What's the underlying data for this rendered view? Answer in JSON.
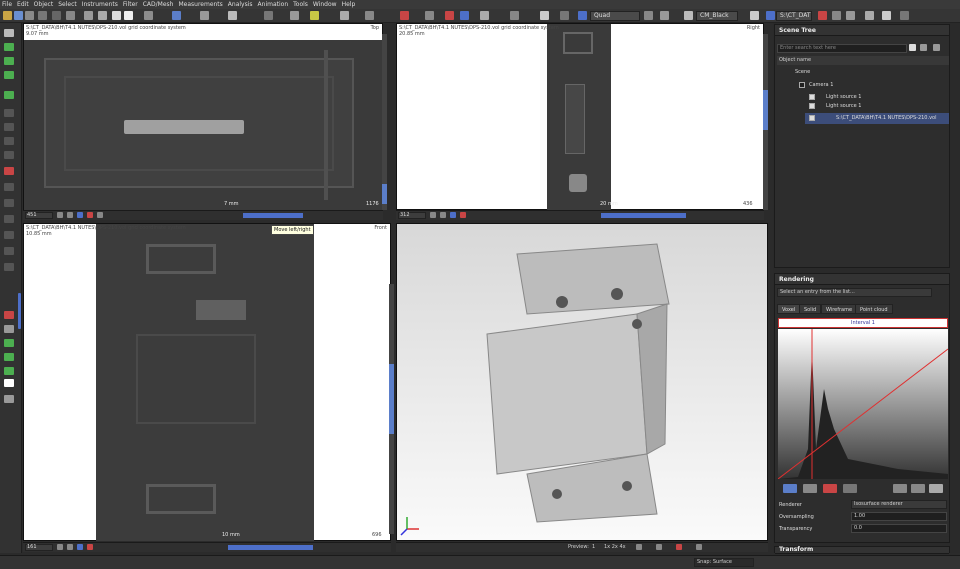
{
  "menu": [
    "File",
    "Edit",
    "Object",
    "Select",
    "Instruments",
    "Filter",
    "CAD/Mesh",
    "Measurements",
    "Analysis",
    "Animation",
    "Tools",
    "Window",
    "Help"
  ],
  "toolbar": {
    "quad_label": "Quad",
    "colormap_label": "CM_Black",
    "path_label": "S:\\CT_DAT"
  },
  "viewports": {
    "top": {
      "path": "S:\\CT_DATA\\BH\\T4.1 NUTES\\DPS-210.vol grid coordinate system",
      "scale_mm": "9.07 mm",
      "corner": "Top",
      "slice": "451",
      "scalebar": "7 mm",
      "extra": "1176"
    },
    "right": {
      "path": "S:\\CT_DATA\\BH\\T4.1 NUTES\\DPS-210.vol grid coordinate system",
      "scale_mm": "20.85 mm",
      "corner": "Right",
      "slice": "312",
      "scalebar": "20 mm",
      "extra": "436"
    },
    "front": {
      "path": "S:\\CT_DATA\\BH\\T4.1 NUTES\\DPS-210.vol grid coordinate system",
      "scale_mm": "10.85 mm",
      "corner": "Front",
      "slice": "161",
      "scalebar": "10 mm",
      "extra": "696"
    },
    "tooltip": "Move left/right"
  },
  "scene_tree": {
    "title": "Scene Tree",
    "search_placeholder": "Enter search text here",
    "col_header": "Object name",
    "items": [
      "Scene",
      "Camera 1",
      "Light source 1",
      "Light source 1",
      "S:\\CT_DATA\\BH\\T4.1 NUTES\\DPS-210.vol"
    ]
  },
  "rendering": {
    "title": "Rendering",
    "select_placeholder": "Select an entry from the list...",
    "tabs": [
      "Voxel",
      "Solid",
      "Wireframe",
      "Point cloud"
    ],
    "interval": "Interval 1",
    "renderer_label": "Renderer",
    "renderer_value": "Isosurface renderer",
    "oversampling_label": "Oversampling",
    "oversampling_value": "1.00",
    "transparency_label": "Transparency",
    "transparency_value": "0.0"
  },
  "transform_title": "Transform",
  "preview": {
    "label": "Preview:",
    "value": "1",
    "zoom": "1x 2x 4x"
  },
  "status": {
    "snap": "Snap: Surface"
  },
  "colors": {
    "accent": "#4d6fc9",
    "tf_line": "#e03030"
  }
}
